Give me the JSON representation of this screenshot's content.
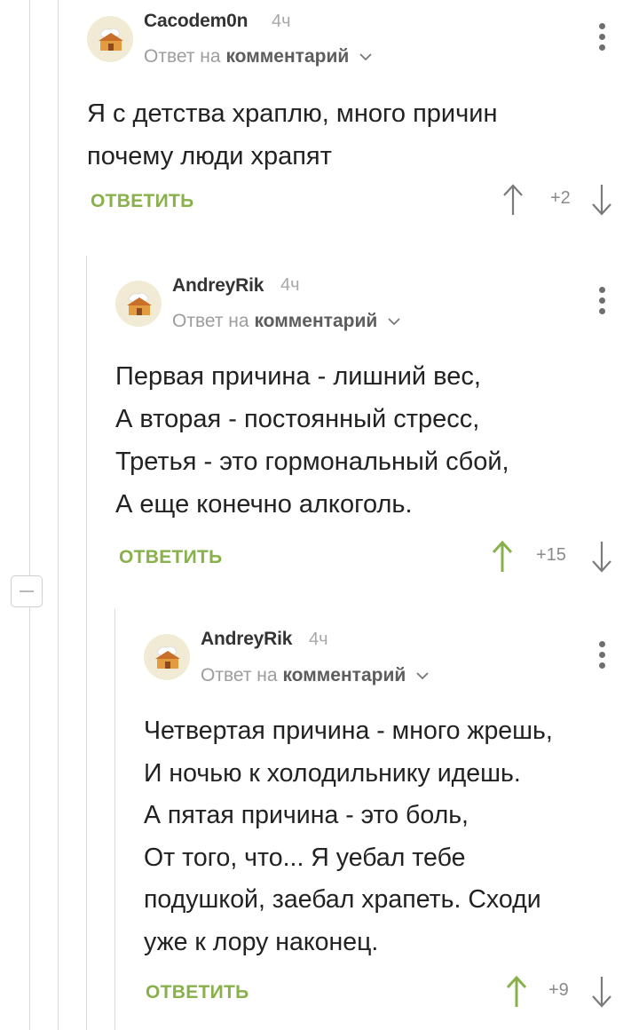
{
  "reply_to": {
    "prefix": "Ответ на",
    "target": "комментарий"
  },
  "comments": [
    {
      "author": "Cacodem0n",
      "time": "4ч",
      "text_lines": [
        "Я с детства храплю, много причин",
        "почему люди храпят"
      ],
      "reply_label": "ОТВЕТИТЬ",
      "score": "+2",
      "upvoted": false
    },
    {
      "author": "AndreyRik",
      "time": "4ч",
      "text_lines": [
        "Первая причина - лишний вес,",
        "А вторая - постоянный стресс,",
        "Третья - это гормональный сбой,",
        "А еще конечно алкоголь."
      ],
      "reply_label": "ОТВЕТИТЬ",
      "score": "+15",
      "upvoted": true
    },
    {
      "author": "AndreyRik",
      "time": "4ч",
      "text_lines": [
        "Четвертая причина - много жрешь,",
        "И ночью к холодильнику идешь.",
        "А пятая причина - это боль,",
        "От того, что... Я уебал тебе",
        "подушкой, заебал храпеть. Сходи",
        "уже к лору наконец."
      ],
      "reply_label": "ОТВЕТИТЬ",
      "score": "+9",
      "upvoted": true
    }
  ],
  "colors": {
    "accent": "#88b14b",
    "line": "#d9d9d9",
    "text": "#222222"
  },
  "icons": [
    "avatar-icon",
    "chevron-down-icon",
    "more-vertical-icon",
    "arrow-up-icon",
    "arrow-down-icon",
    "collapse-minus-icon"
  ]
}
